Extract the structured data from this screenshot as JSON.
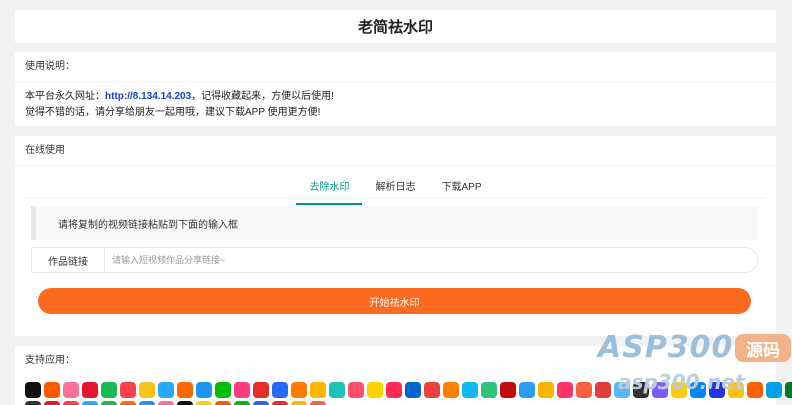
{
  "header": {
    "title": "老简祛水印"
  },
  "info": {
    "title": "使用说明：",
    "line1_prefix": "本平台永久网址：",
    "url": "http://8.134.14.203",
    "line1_suffix": "，记得收藏起来，方便以后使用!",
    "line2": "觉得不错的话，请分享给朋友一起用哦，建议下载APP 使用更方便!"
  },
  "online": {
    "title": "在线使用",
    "tabs": [
      {
        "label": "去除水印",
        "active": true
      },
      {
        "label": "解析日志",
        "active": false
      },
      {
        "label": "下载APP",
        "active": false
      }
    ],
    "notice": "请将复制的视频链接粘贴到下面的输入框",
    "form_label": "作品链接",
    "input_placeholder": "请输入短视频作品分享链接~",
    "input_value": "",
    "submit_label": "开始祛水印"
  },
  "support": {
    "title": "支持应用：",
    "apps_row1": [
      "tiktok",
      "kuaishou",
      "bilibili",
      "weibo",
      "xigua",
      "huoshan",
      "pipixia",
      "momo",
      "weishi",
      "youku",
      "iqiyi",
      "meipai",
      "acfun",
      "haokan",
      "douyu",
      "huya",
      "zuiyou",
      "quanmin",
      "kuaikan",
      "xiaohongshu",
      "lishipin",
      "toutiao",
      "miaopai",
      "tencent",
      "qq-music",
      "netease",
      "kugou",
      "kuwo",
      "lizhi",
      "ximalaya",
      "changba",
      "quduopai",
      "duitang",
      "xinpianchang",
      "yy",
      "zhihu",
      "baidu",
      "sohu",
      "mgtv",
      "pptv",
      "douban",
      "qq"
    ],
    "apps_row1_colors": [
      "#111111",
      "#ff5a00",
      "#fb7299",
      "#e6162d",
      "#19b955",
      "#ff3f4a",
      "#f9c31c",
      "#2aa7ff",
      "#ff6a00",
      "#1e95f0",
      "#00be06",
      "#ff3b7f",
      "#e52e2e",
      "#2868f6",
      "#ff7a00",
      "#ffb400",
      "#1cc3b6",
      "#ff4f6d",
      "#ffd300",
      "#fe2c55",
      "#0066cc",
      "#ed4040",
      "#ff8000",
      "#12b7f5",
      "#31c27c",
      "#c20c0c",
      "#2c9cf2",
      "#f8b500",
      "#ff3366",
      "#f86442",
      "#e03e3e",
      "#5ab5fc",
      "#333333",
      "#7c5cff",
      "#ffcc00",
      "#0084ff",
      "#2932e1",
      "#ffc20e",
      "#ff5f00",
      "#009fe8",
      "#007722",
      "#12b7f5"
    ],
    "apps_row2_colors": [
      "#333333",
      "#e6162d",
      "#ff3f4a",
      "#2aa7ff",
      "#19b955",
      "#ff6a00",
      "#1e95f0",
      "#fb7299",
      "#111111",
      "#ffd300",
      "#ff5a00",
      "#00be06",
      "#2868f6",
      "#e52e2e",
      "#ffb400",
      "#f86442"
    ]
  },
  "watermark": {
    "logo": "ASP300",
    "tag": "源码",
    "url": "asp300.net"
  }
}
